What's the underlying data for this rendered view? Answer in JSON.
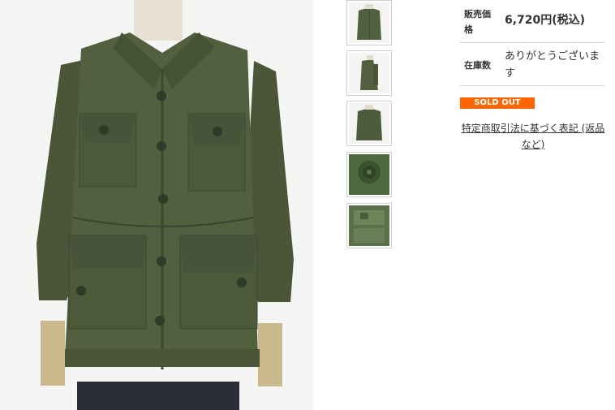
{
  "product": {
    "price_label": "販売価格",
    "price_value": "6,720円(税込)",
    "stock_label": "在庫数",
    "stock_value": "ありがとうございます",
    "sold_out_badge": "SOLD OUT",
    "legal_link": "特定商取引法に基づく表記 (返品など)"
  },
  "colors": {
    "jacket": "#4e5a3a",
    "sold_out": "#ff6600"
  },
  "images": {
    "main": "olive-green-field-jacket-photo",
    "thumbnails": [
      "jacket-front-thumb",
      "jacket-side-thumb",
      "jacket-back-thumb",
      "button-closeup-thumb",
      "label-closeup-thumb"
    ]
  }
}
